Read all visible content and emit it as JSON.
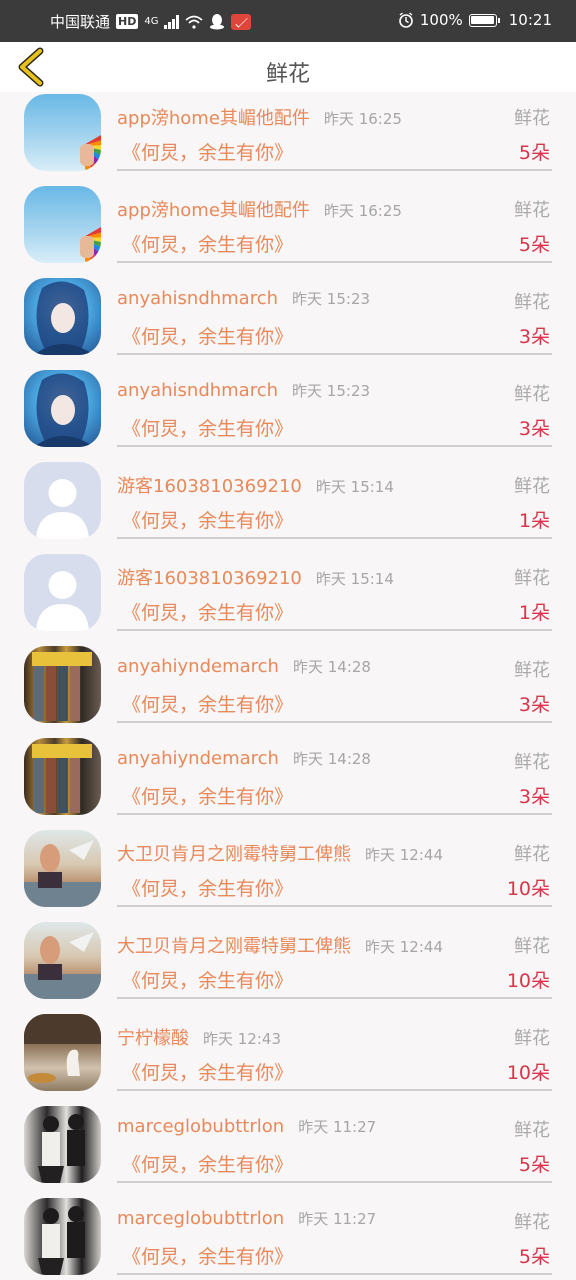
{
  "status_bar": {
    "carrier": "中国联通",
    "hd": "HD",
    "network": "4G",
    "battery": "100%",
    "time": "10:21",
    "icons": [
      "signal-icon",
      "wifi-icon",
      "qq-icon",
      "mail-icon",
      "alarm-icon",
      "battery-icon"
    ]
  },
  "header": {
    "title": "鲜花",
    "back_icon": "back-chevron-icon",
    "accent": "#e7c21b"
  },
  "colors": {
    "name": "#e8895a",
    "count": "#d8354a",
    "muted": "#a6a6a6"
  },
  "items": [
    {
      "name": "app滂home其嵋他配件",
      "time": "昨天 16:25",
      "category": "鲜花",
      "message": "《何炅，余生有你》",
      "count": "5朵",
      "avatar": "fan"
    },
    {
      "name": "app滂home其嵋他配件",
      "time": "昨天 16:25",
      "category": "鲜花",
      "message": "《何炅，余生有你》",
      "count": "5朵",
      "avatar": "fan"
    },
    {
      "name": "anyahisndhmarch",
      "time": "昨天 15:23",
      "category": "鲜花",
      "message": "《何炅，余生有你》",
      "count": "3朵",
      "avatar": "anime"
    },
    {
      "name": "anyahisndhmarch",
      "time": "昨天 15:23",
      "category": "鲜花",
      "message": "《何炅，余生有你》",
      "count": "3朵",
      "avatar": "anime"
    },
    {
      "name": "游客1603810369210",
      "time": "昨天 15:14",
      "category": "鲜花",
      "message": "《何炅，余生有你》",
      "count": "1朵",
      "avatar": "default"
    },
    {
      "name": "游客1603810369210",
      "time": "昨天 15:14",
      "category": "鲜花",
      "message": "《何炅，余生有你》",
      "count": "1朵",
      "avatar": "default"
    },
    {
      "name": "anyahiyndemarch",
      "time": "昨天 14:28",
      "category": "鲜花",
      "message": "《何炅，余生有你》",
      "count": "3朵",
      "avatar": "bottles"
    },
    {
      "name": "anyahiyndemarch",
      "time": "昨天 14:28",
      "category": "鲜花",
      "message": "《何炅，余生有你》",
      "count": "3朵",
      "avatar": "bottles"
    },
    {
      "name": "大卫贝肯月之刚霉特舅工俾熊",
      "time": "昨天 12:44",
      "category": "鲜花",
      "message": "《何炅，余生有你》",
      "count": "10朵",
      "avatar": "beach"
    },
    {
      "name": "大卫贝肯月之刚霉特舅工俾熊",
      "time": "昨天 12:44",
      "category": "鲜花",
      "message": "《何炅，余生有你》",
      "count": "10朵",
      "avatar": "beach"
    },
    {
      "name": "宁柠檬酸",
      "time": "昨天 12:43",
      "category": "鲜花",
      "message": "《何炅，余生有你》",
      "count": "10朵",
      "avatar": "cafe"
    },
    {
      "name": "marceglobubttrlon",
      "time": "昨天 11:27",
      "category": "鲜花",
      "message": "《何炅，余生有你》",
      "count": "5朵",
      "avatar": "couple"
    },
    {
      "name": "marceglobubttrlon",
      "time": "昨天 11:27",
      "category": "鲜花",
      "message": "《何炅，余生有你》",
      "count": "5朵",
      "avatar": "couple"
    }
  ]
}
